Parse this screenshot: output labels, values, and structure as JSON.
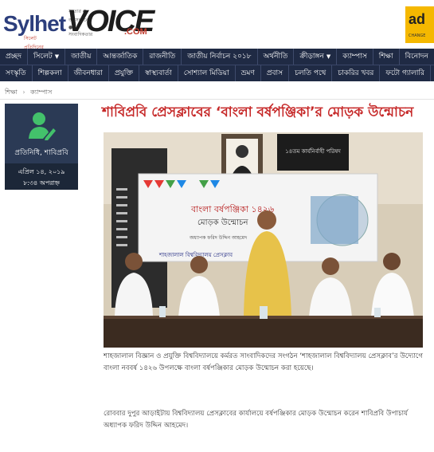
{
  "header": {
    "logo_main": "Sylhet",
    "logo_voice": "VOICE",
    "logo_com": ".COM",
    "logo_tagline": "সিলেট প্রতিদিনের ভয়েস",
    "logo_top_tagline": "সত্যের ● অনুসন্ধানের ● সংবাদিকতার",
    "ad_text": "ad",
    "ad_sub": "CHANGE"
  },
  "nav": {
    "row1": [
      {
        "label": "প্রচ্ছদ",
        "active": false
      },
      {
        "label": "সিলেট",
        "active": false,
        "dropdown": true
      },
      {
        "label": "জাতীয়",
        "active": false
      },
      {
        "label": "আন্তর্জাতিক",
        "active": false
      },
      {
        "label": "রাজনীতি",
        "active": false
      },
      {
        "label": "জাতীয় নির্বাচন ২০১৮",
        "active": false
      },
      {
        "label": "অর্থনীতি",
        "active": false
      },
      {
        "label": "ক্রীড়াঙ্গন",
        "active": false,
        "dropdown": true
      },
      {
        "label": "ক্যাম্পাস",
        "active": false
      },
      {
        "label": "শিক্ষা",
        "active": false
      },
      {
        "label": "বিনোদন",
        "active": false
      }
    ],
    "row2": [
      {
        "label": "সংস্কৃতি",
        "active": false
      },
      {
        "label": "শিল্পকলা",
        "active": false
      },
      {
        "label": "জীবনধারা",
        "active": false
      },
      {
        "label": "প্রযুক্তি",
        "active": false
      },
      {
        "label": "স্বাস্থ্যবার্তা",
        "active": false
      },
      {
        "label": "সোশ্যাল মিডিয়া",
        "active": false
      },
      {
        "label": "ভ্রমণ",
        "active": false
      },
      {
        "label": "প্রবাস",
        "active": false
      },
      {
        "label": "চলতি পথে",
        "active": false
      },
      {
        "label": "চাকরির খবর",
        "active": false
      },
      {
        "label": "ফটো গ্যালারি",
        "active": false
      }
    ]
  },
  "breadcrumb": [
    "শিক্ষা",
    "ক্যাম্পাস"
  ],
  "author": {
    "name": "প্রতিনিধি, শাবিপ্রবি",
    "date": "এপ্রিল ১৪, ২০১৯",
    "time": "৮:৩৪ অপরাহ্ন"
  },
  "article": {
    "title": "শাবিপ্রবি প্রেসক্লাবের ‘বাংলা বর্ষপঞ্জিকা’র মোড়ক উন্মোচন",
    "photo_banner_title": "বাংলা বর্ষপঞ্জিকা ১৪২৬",
    "photo_banner_sub": "মোড়ক উন্মোচন",
    "photo_banner_guest": "অধ্যাপক ফরিদ উদ্দিন আহমেদ",
    "photo_banner_org": "শাহজালাল বিশ্ববিদ্যালয় প্রেসক্লাব",
    "photo_board_text": "১৪তম কার্যনির্বাহী পরিষদ",
    "para1": "শাহজালাল বিজ্ঞান ও প্রযুক্তি বিশ্ববিদ্যালয়ে কর্মরত সাংবাদিকদের সংগঠন ‘শাহজালাল বিশ্ববিদ্যালয় প্রেসক্লাব’র উদ্যোগে বাংলা নববর্ষ ১৪২৬ উপলক্ষে বাংলা বর্ষপঞ্জিকার মোড়ক উন্মোচন করা হয়েছে।",
    "para2": "রোববার দুপুর আড়াইটায় বিশ্ববিদ্যালয় প্রেসক্লাবের কার্যালয়ে বর্ষপঞ্জিকার মোড়ক উন্মোচন করেন শাবিপ্রবি উপাচার্য অধ্যাপক ফরিদ উদ্দিন আহমেদ।"
  },
  "colors": {
    "nav_bg": "#1f2a44",
    "nav_active": "#b71c1c",
    "title": "#c62828",
    "author_card": "#2b3a55",
    "author_icon": "#43c16b",
    "ad_bg": "#f5b800"
  }
}
